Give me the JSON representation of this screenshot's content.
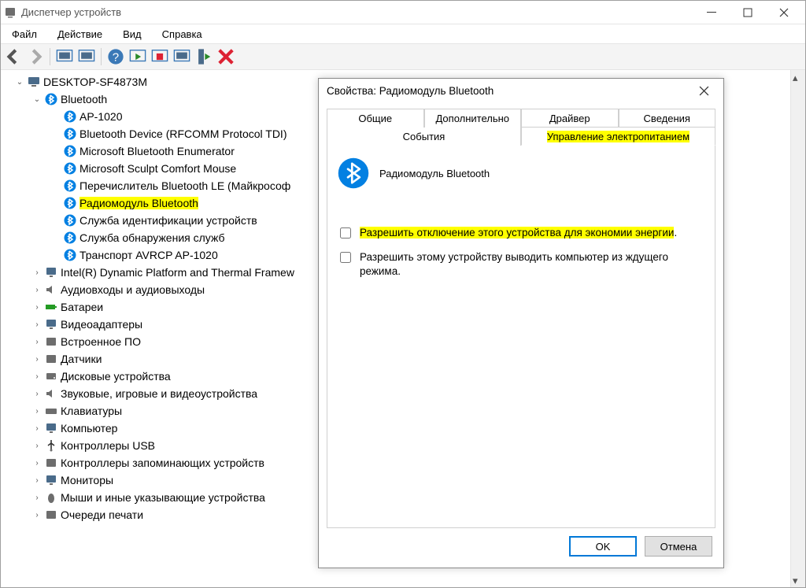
{
  "window": {
    "title": "Диспетчер устройств",
    "menu": {
      "file": "Файл",
      "action": "Действие",
      "view": "Вид",
      "help": "Справка"
    },
    "toolbar_icons": [
      "back",
      "forward",
      "sep",
      "screen-a",
      "screen-b",
      "sep",
      "help",
      "play",
      "stop",
      "screen-c",
      "green-play",
      "red-x"
    ]
  },
  "tree": {
    "root": "DESKTOP-SF4873M",
    "bluetooth_label": "Bluetooth",
    "bluetooth_items": [
      "AP-1020",
      "Bluetooth Device (RFCOMM Protocol TDI)",
      "Microsoft Bluetooth Enumerator",
      "Microsoft Sculpt Comfort Mouse",
      "Перечислитель Bluetooth LE (Майкрософ",
      "Радиомодуль Bluetooth",
      "Служба идентификации устройств",
      "Служба обнаружения служб",
      "Транспорт AVRCP AP-1020"
    ],
    "bluetooth_highlight_index": 5,
    "categories": [
      "Intel(R) Dynamic Platform and Thermal Framew",
      "Аудиовходы и аудиовыходы",
      "Батареи",
      "Видеоадаптеры",
      "Встроенное ПО",
      "Датчики",
      "Дисковые устройства",
      "Звуковые, игровые и видеоустройства",
      "Клавиатуры",
      "Компьютер",
      "Контроллеры USB",
      "Контроллеры запоминающих устройств",
      "Мониторы",
      "Мыши и иные указывающие устройства",
      "Очереди печати"
    ]
  },
  "dialog": {
    "title": "Свойства: Радиомодуль Bluetooth",
    "tabs": {
      "general": "Общие",
      "advanced": "Дополнительно",
      "driver": "Драйвер",
      "details": "Сведения",
      "events": "События",
      "power": "Управление электропитанием"
    },
    "device_name": "Радиомодуль Bluetooth",
    "check_power_off": "Разрешить отключение этого устройства для экономии энергии",
    "check_power_off_period": ".",
    "check_wake": "Разрешить этому устройству выводить компьютер из ждущего режима.",
    "ok": "OK",
    "cancel": "Отмена"
  }
}
